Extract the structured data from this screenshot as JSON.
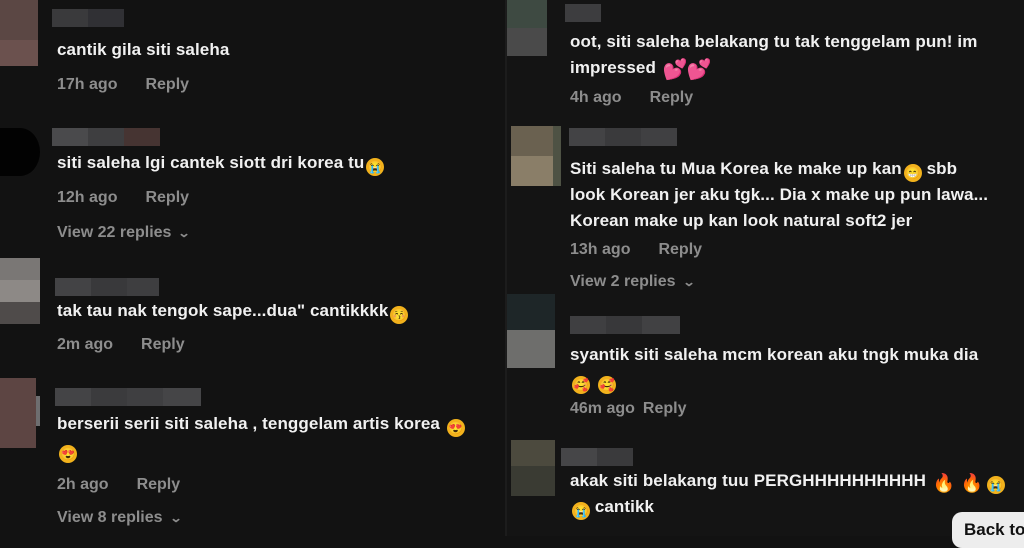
{
  "left_comments": [
    {
      "text": "cantik gila siti saleha",
      "time": "17h ago",
      "reply": "Reply"
    },
    {
      "text": "siti saleha lgi cantek siott dri korea tu",
      "time": "12h ago",
      "reply": "Reply",
      "replies": "View 22 replies"
    },
    {
      "text": "tak tau nak tengok sape...dua\" cantikkkk",
      "time": "2m ago",
      "reply": "Reply"
    },
    {
      "text": "berserii serii siti saleha , tenggelam artis korea",
      "time": "2h ago",
      "reply": "Reply",
      "replies": "View 8 replies"
    }
  ],
  "right_comments": [
    {
      "line1": "oot, siti saleha belakang tu tak tenggelam pun! im",
      "line2": "impressed",
      "time": "4h ago",
      "reply": "Reply"
    },
    {
      "line1": "Siti saleha tu Mua Korea ke make up kan",
      "line1b": "sbb",
      "line2": "look Korean jer aku tgk... Dia x make up pun lawa...",
      "line3": "Korean make up kan look natural soft2 jer",
      "time": "13h ago",
      "reply": "Reply",
      "replies": "View 2 replies"
    },
    {
      "line1": "syantik siti saleha mcm korean aku tngk muka dia",
      "time": "46m ago",
      "reply": "Reply"
    },
    {
      "line1": "akak siti belakang tuu PERGHHHHHHHHHH",
      "line2": "cantikk"
    }
  ],
  "back_button": "Back to",
  "icons": {
    "chevron": "chevron-down-icon",
    "emoji": [
      "loudly-crying-face",
      "kissing-face",
      "grinning-face",
      "smiling-face-with-hearts",
      "heart-eyes",
      "two-hearts",
      "fire"
    ]
  }
}
